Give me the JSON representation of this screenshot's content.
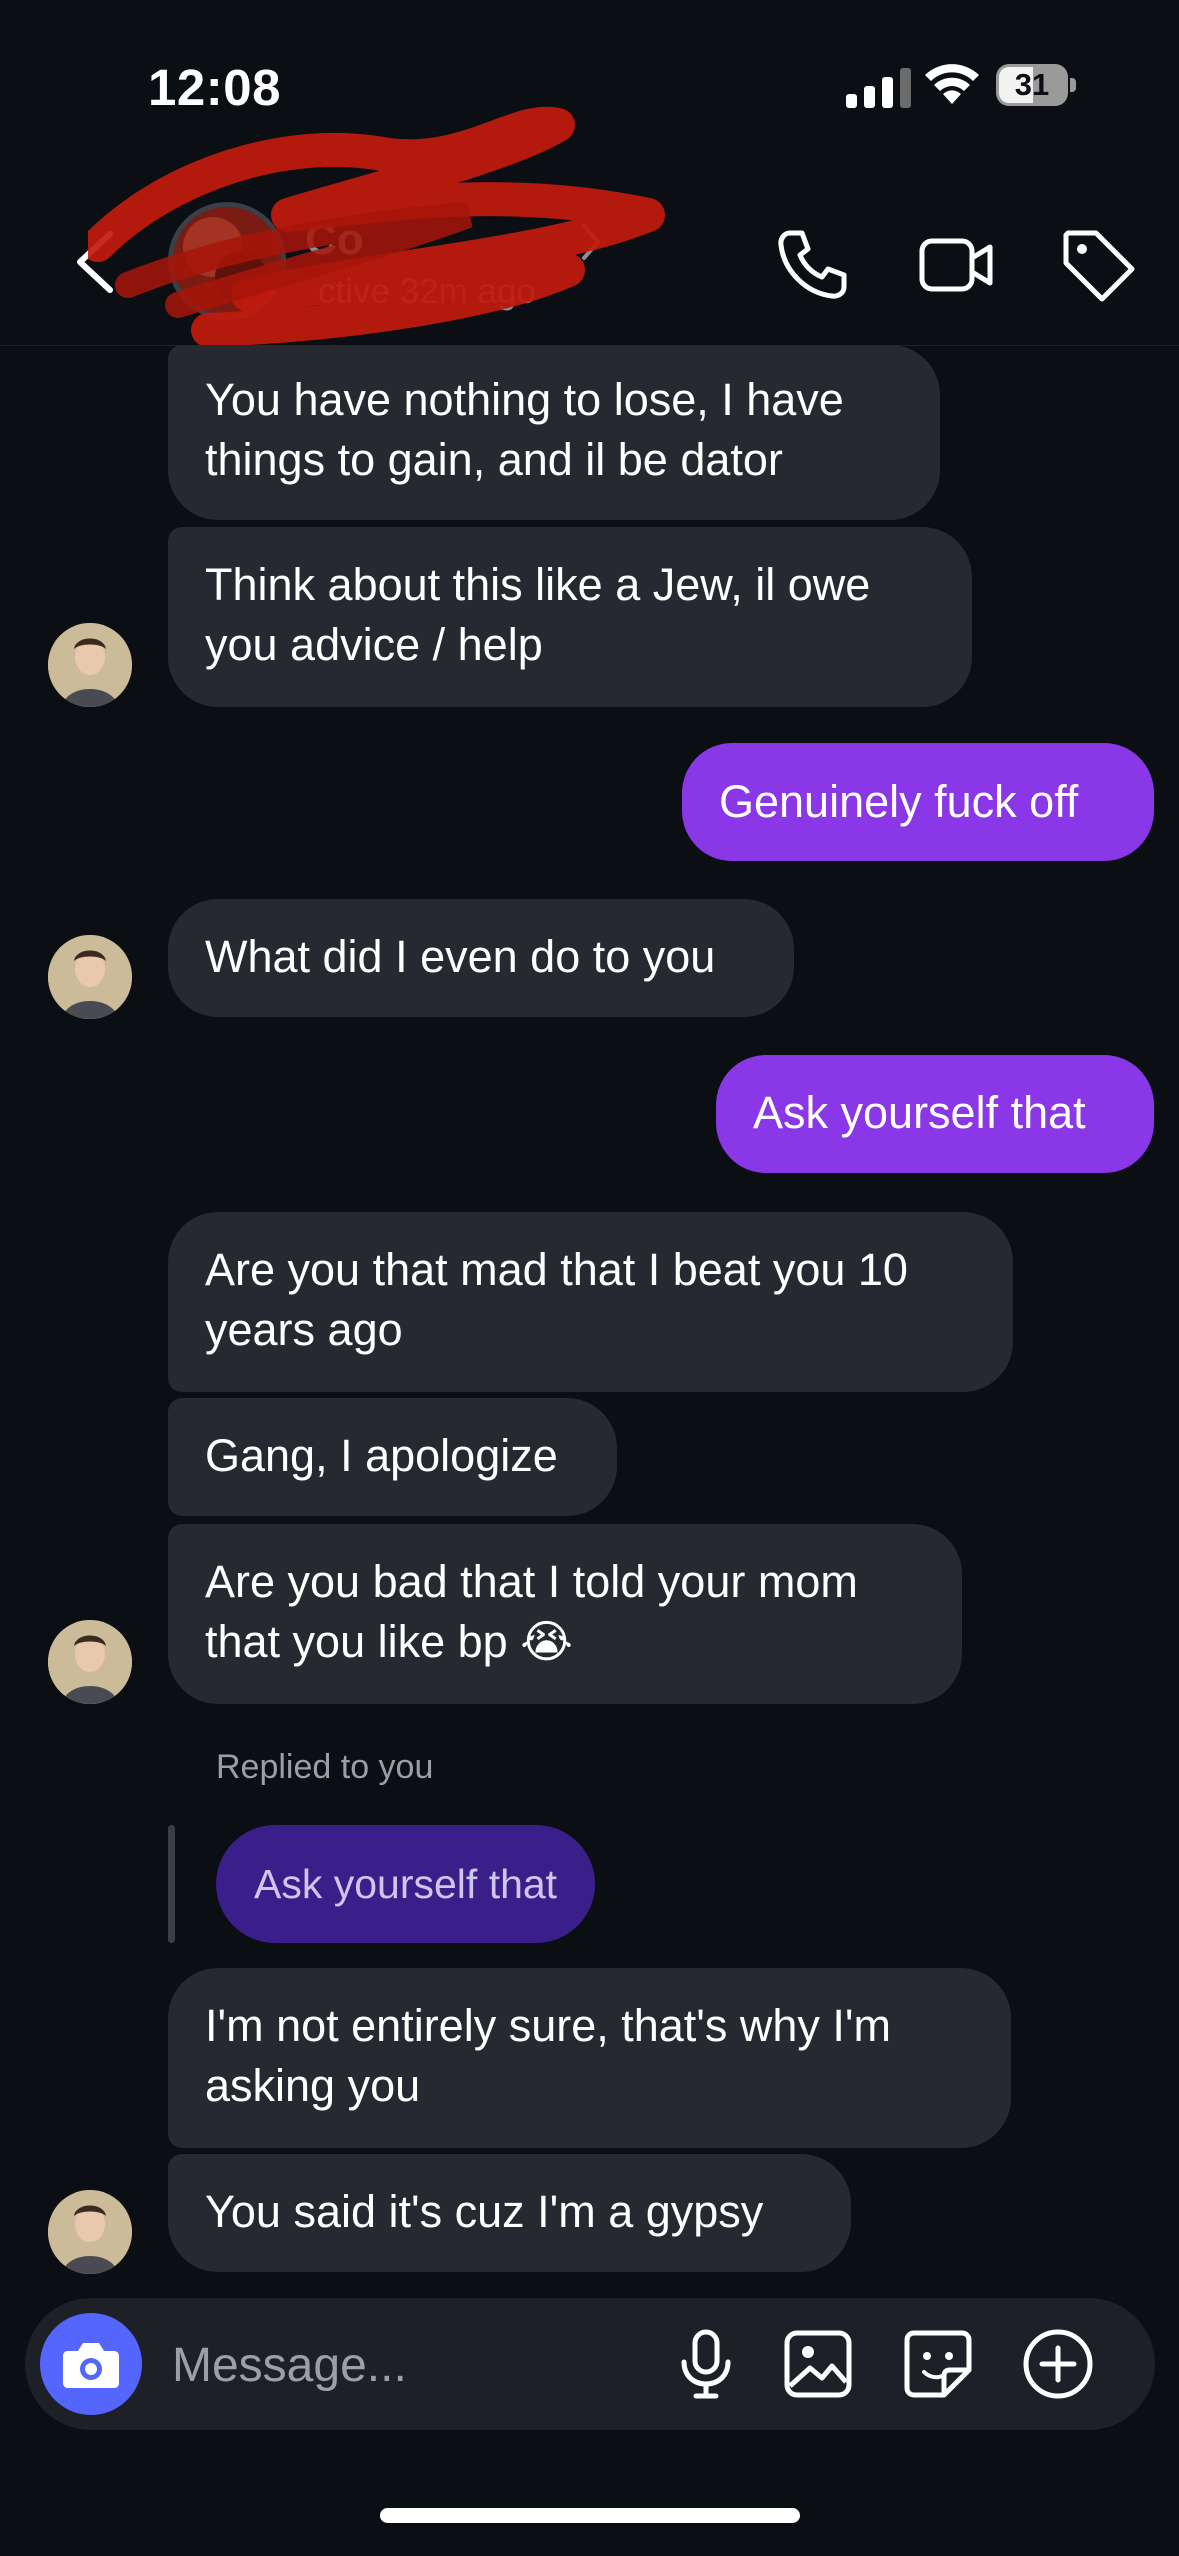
{
  "status_bar": {
    "time": "12:08",
    "battery": "31"
  },
  "header": {
    "contact_name": "Co",
    "status_text": "ctive 32m ago",
    "icons": [
      "back-chevron-icon",
      "phone-icon",
      "video-camera-icon",
      "tag-icon"
    ]
  },
  "messages": [
    {
      "text_lines": [
        "You have nothing to lose, I have",
        "things to gain, and il be dator"
      ],
      "sender": "them"
    },
    {
      "text_lines": [
        "Think about this like a Jew, il owe",
        "you advice / help"
      ],
      "sender": "them"
    },
    {
      "text": "Genuinely fuck off",
      "sender": "me"
    },
    {
      "text": "What did I even do to you",
      "sender": "them"
    },
    {
      "text": "Ask yourself that",
      "sender": "me"
    },
    {
      "text_lines": [
        "Are you that mad that I beat you 10",
        "years ago"
      ],
      "sender": "them"
    },
    {
      "text": "Gang, I apologize",
      "sender": "them"
    },
    {
      "text_lines": [
        "Are you bad that I told your mom",
        "that you like bp 😭"
      ],
      "sender": "them"
    },
    {
      "text_lines": [
        "I'm not entirely sure, that's why I'm",
        "asking you"
      ],
      "sender": "them"
    },
    {
      "text": "You said it's cuz I'm a gypsy",
      "sender": "them"
    }
  ],
  "reply": {
    "label": "Replied to you",
    "quoted": "Ask yourself that"
  },
  "composer": {
    "placeholder": "Message...",
    "icons": [
      "camera-icon",
      "microphone-icon",
      "image-icon",
      "sticker-icon",
      "plus-circle-icon"
    ]
  },
  "colors": {
    "background": "#0b0f14",
    "incoming": "#262a30",
    "outgoing": "#8a37e8",
    "camera": "#5566ff"
  }
}
